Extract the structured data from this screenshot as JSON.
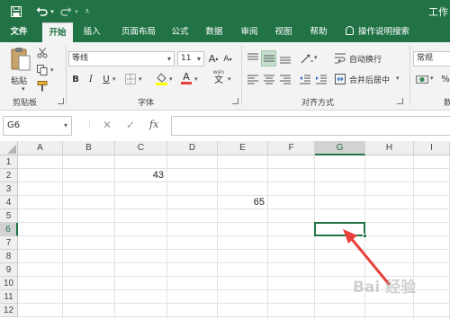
{
  "title_bar": {
    "title": "工作",
    "quick_access": {
      "save": "save-icon",
      "undo": "undo-icon",
      "redo": "redo-icon",
      "customize": "customize-icon"
    }
  },
  "tabs": [
    "文件",
    "开始",
    "插入",
    "页面布局",
    "公式",
    "数据",
    "审阅",
    "视图",
    "帮助"
  ],
  "active_tab": "开始",
  "tell_me": "操作说明搜索",
  "ribbon": {
    "clipboard": {
      "paste_label": "粘贴",
      "group_label": "剪贴板"
    },
    "font": {
      "name": "等线",
      "size": "11",
      "grow": "A",
      "shrink": "A",
      "bold": "B",
      "italic": "I",
      "underline": "U",
      "font_color": "A",
      "phonetic": "wén",
      "group_label": "字体"
    },
    "alignment": {
      "wrap_text": "自动换行",
      "merge_center": "合并后居中",
      "group_label": "对齐方式"
    },
    "number": {
      "format": "常规",
      "group_label": "数"
    }
  },
  "formula_bar": {
    "name_box": "G6",
    "cancel": "✕",
    "enter": "✓",
    "fx": "fx",
    "value": ""
  },
  "grid": {
    "columns": [
      "A",
      "B",
      "C",
      "D",
      "E",
      "F",
      "G",
      "H",
      "I"
    ],
    "rows": [
      "1",
      "2",
      "3",
      "4",
      "5",
      "6",
      "7",
      "8",
      "9",
      "10",
      "11",
      "12"
    ],
    "selected_cell": "G6",
    "cells": [
      {
        "ref": "C2",
        "value": "43"
      },
      {
        "ref": "E4",
        "value": "65"
      }
    ]
  },
  "colors": {
    "excel_green": "#217346",
    "annotation_red": "#e8413d"
  }
}
